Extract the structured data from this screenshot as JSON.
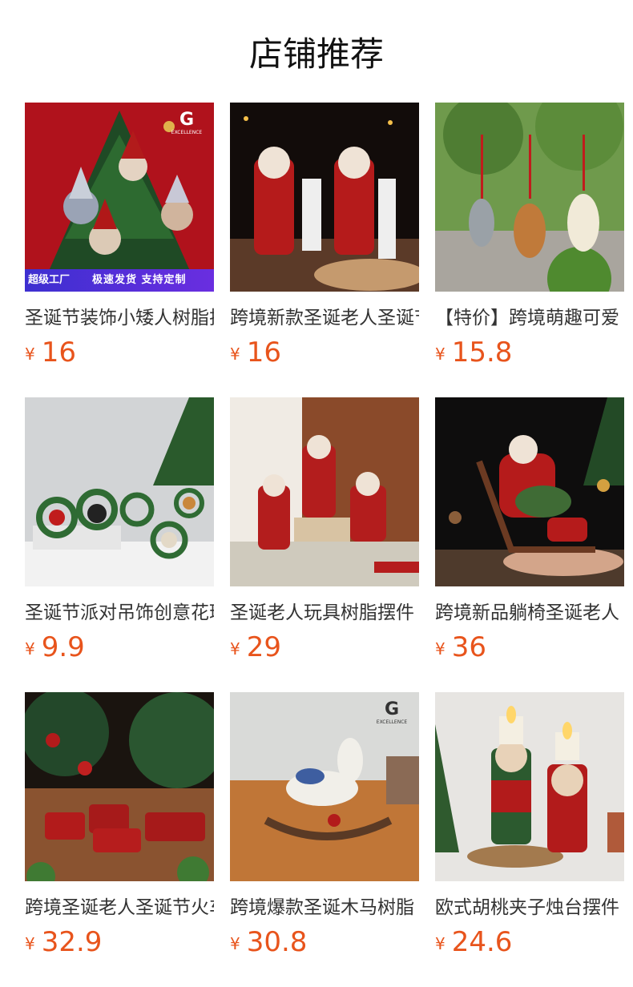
{
  "title": "店铺推荐",
  "currency": "¥",
  "badges": {
    "left": "超级工厂",
    "right": "极速发货 支持定制",
    "brand_letter": "G"
  },
  "products": [
    {
      "name": "圣诞节装饰小矮人树脂挂件",
      "price": "16"
    },
    {
      "name": "跨境新款圣诞老人圣诞节",
      "price": "16"
    },
    {
      "name": "【特价】跨境萌趣可爱",
      "price": "15.8"
    },
    {
      "name": "圣诞节派对吊饰创意花环",
      "price": "9.9"
    },
    {
      "name": "圣诞老人玩具树脂摆件",
      "price": "29"
    },
    {
      "name": "跨境新品躺椅圣诞老人",
      "price": "36"
    },
    {
      "name": "跨境圣诞老人圣诞节火车",
      "price": "32.9"
    },
    {
      "name": "跨境爆款圣诞木马树脂",
      "price": "30.8"
    },
    {
      "name": "欧式胡桃夹子烛台摆件",
      "price": "24.6"
    }
  ]
}
